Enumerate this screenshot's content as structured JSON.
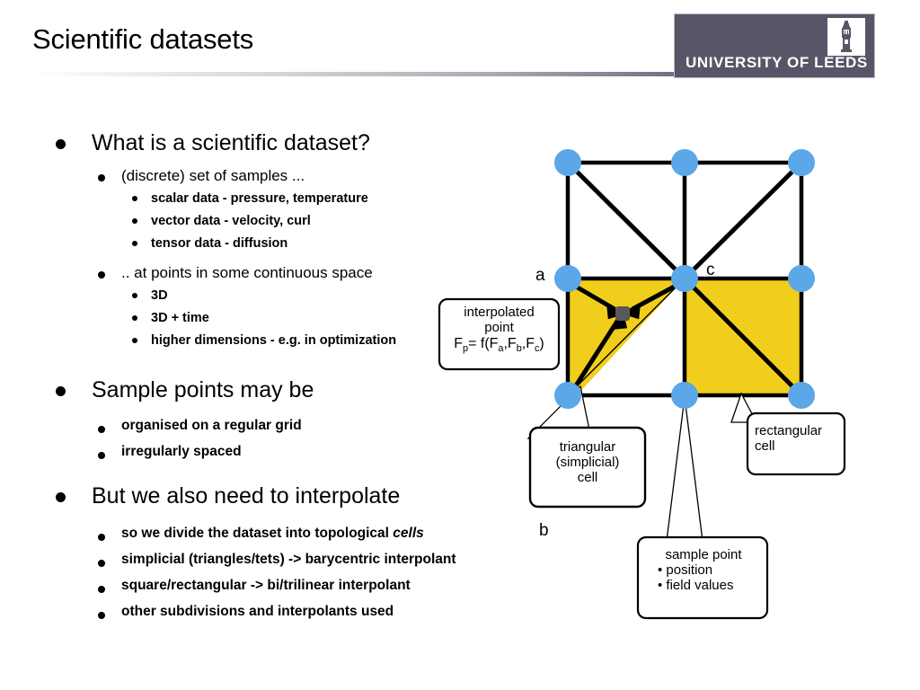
{
  "header": {
    "title": "Scientific datasets",
    "logo_text": "UNIVERSITY OF LEEDS",
    "logo_bg": "#565668",
    "rule_color": "#6f6f80"
  },
  "content": {
    "groups": [
      {
        "heading": "What is a scientific dataset?",
        "subs": [
          {
            "text": "(discrete) set of samples ...",
            "items": [
              "scalar data - pressure, temperature",
              "vector data - velocity, curl",
              "tensor data - diffusion"
            ]
          },
          {
            "text": ".. at points in some continuous space",
            "items": [
              "3D",
              "3D + time",
              "higher dimensions - e.g. in optimization"
            ]
          }
        ]
      },
      {
        "heading": "Sample points may be",
        "items": [
          "organised on a regular grid",
          "irregularly spaced"
        ]
      },
      {
        "heading": "But we also need to interpolate",
        "items_pre": [
          "so we divide the dataset into topological ",
          "simplicial (triangles/tets) -> barycentric interpolant",
          "square/rectangular -> bi/trilinear interpolant",
          "other subdivisions and interpolants used"
        ],
        "italic_word": "cells"
      }
    ]
  },
  "diagram": {
    "colors": {
      "node_blue": "#5BA7E8",
      "cell_yellow": "#F2CE1C",
      "interp_point": "#595959",
      "edge": "#000000"
    },
    "node_labels": {
      "a": "a",
      "b": "b",
      "c": "c"
    },
    "callouts": {
      "interpolated": {
        "line1": "interpolated",
        "line2": "point",
        "formula_prefix": "F",
        "formula_sub1": "p",
        "formula_mid": "= f(F",
        "formula_sub2": "a",
        "formula_c1": ",F",
        "formula_sub3": "b",
        "formula_c2": ",F",
        "formula_sub4": "c",
        "formula_end": ")"
      },
      "triangular": {
        "line1": "triangular",
        "line2": "(simplicial)",
        "line3": "cell"
      },
      "rectangular": {
        "line1": "rectangular",
        "line2": "cell"
      },
      "sample_point": {
        "title": "sample point",
        "b1": "• position",
        "b2": "• field values"
      }
    }
  }
}
